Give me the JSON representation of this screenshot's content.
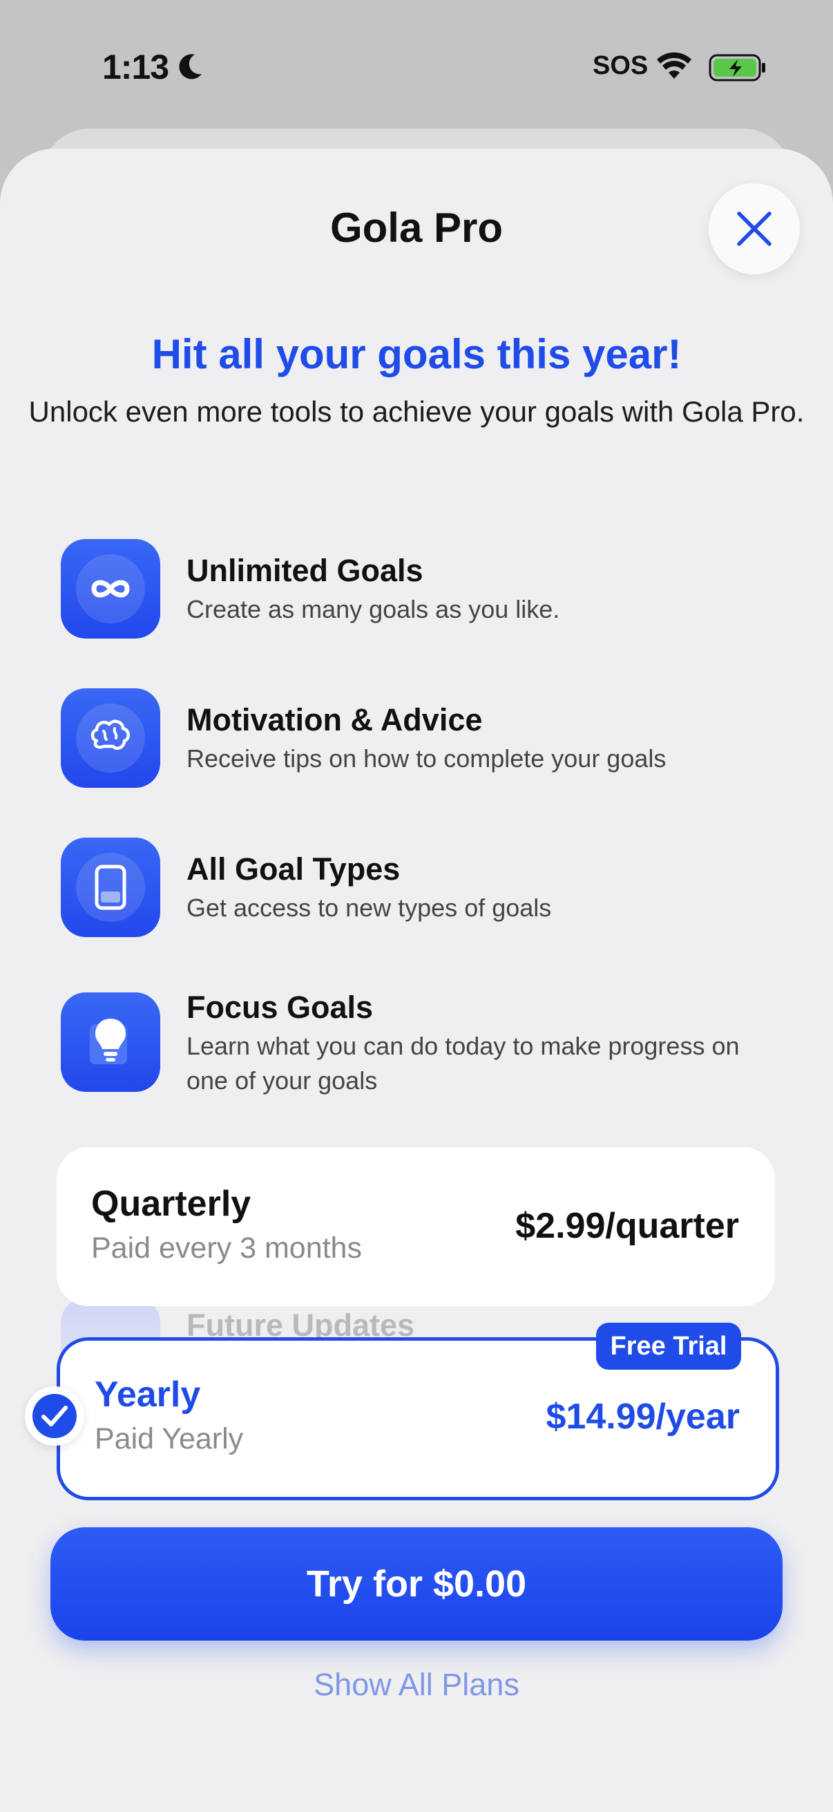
{
  "status_bar": {
    "time": "1:13",
    "carrier": "SOS"
  },
  "sheet": {
    "title": "Gola Pro"
  },
  "hero": {
    "headline": "Hit all your goals this year!",
    "subline": "Unlock even more tools to achieve your goals with Gola Pro."
  },
  "features": [
    {
      "icon": "infinity-icon",
      "title": "Unlimited Goals",
      "desc": "Create as many goals as you like."
    },
    {
      "icon": "brain-icon",
      "title": "Motivation & Advice",
      "desc": "Receive tips on how to complete your goals"
    },
    {
      "icon": "goal-card-icon",
      "title": "All Goal Types",
      "desc": "Get access to new types of goals"
    },
    {
      "icon": "lightbulb-icon",
      "title": "Focus Goals",
      "desc": "Learn what you can do today to make progress on one of your goals"
    },
    {
      "icon": "refresh-icon",
      "title": "Future Updates"
    }
  ],
  "plans": {
    "quarterly": {
      "name": "Quarterly",
      "sub": "Paid every 3 months",
      "price": "$2.99/quarter"
    },
    "yearly": {
      "name": "Yearly",
      "sub": "Paid Yearly",
      "price": "$14.99/year",
      "badge": "Free Trial",
      "selected": true
    }
  },
  "cta": {
    "label": "Try for $0.00"
  },
  "footer": {
    "show_all": "Show All Plans"
  },
  "colors": {
    "accent": "#1f4be8",
    "background": "#efeff1",
    "card": "#ffffff",
    "muted": "#8a8a8e"
  }
}
